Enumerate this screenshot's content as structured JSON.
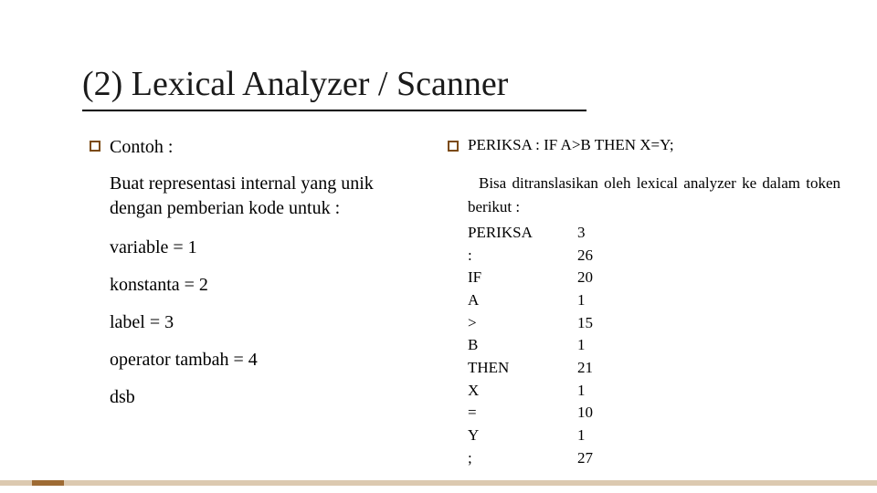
{
  "title": "(2) Lexical Analyzer / Scanner",
  "left": {
    "heading": "Contoh :",
    "intro": "Buat representasi internal yang unik dengan pemberian kode untuk :",
    "assignments": [
      "variable = 1",
      "konstanta = 2",
      "label = 3",
      "operator tambah = 4",
      "dsb"
    ]
  },
  "right": {
    "heading": "PERIKSA : IF A>B THEN X=Y;",
    "para": "Bisa ditranslasikan oleh lexical analyzer ke dalam token berikut :",
    "tokens": [
      {
        "name": "PERIKSA",
        "code": "3"
      },
      {
        "name": ":",
        "code": "26"
      },
      {
        "name": "IF",
        "code": "20"
      },
      {
        "name": "A",
        "code": "1"
      },
      {
        "name": ">",
        "code": "15"
      },
      {
        "name": "B",
        "code": "1"
      },
      {
        "name": "THEN",
        "code": "21"
      },
      {
        "name": "X",
        "code": "1"
      },
      {
        "name": "=",
        "code": "10"
      },
      {
        "name": "Y",
        "code": "1"
      },
      {
        "name": ";",
        "code": "27"
      }
    ]
  }
}
